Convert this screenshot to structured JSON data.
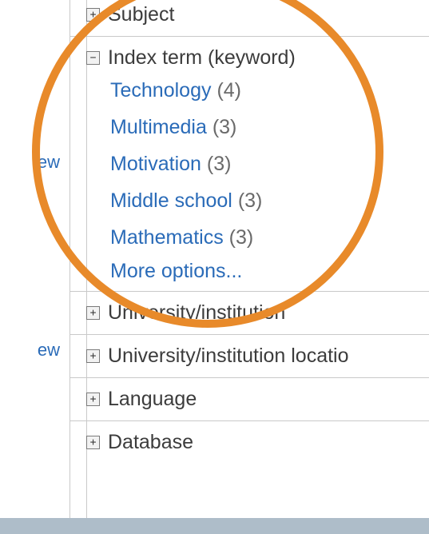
{
  "left": {
    "link1": "ew",
    "link2": "ew"
  },
  "filters": {
    "subject": {
      "label": "Subject",
      "expanded": false
    },
    "index_term": {
      "label": "Index term (keyword)",
      "expanded": true,
      "terms": [
        {
          "label": "Technology",
          "count": "(4)"
        },
        {
          "label": "Multimedia",
          "count": "(3)"
        },
        {
          "label": "Motivation",
          "count": "(3)"
        },
        {
          "label": "Middle school",
          "count": "(3)"
        },
        {
          "label": "Mathematics",
          "count": "(3)"
        }
      ],
      "more": "More options..."
    },
    "univ": {
      "label": "University/institution",
      "expanded": false
    },
    "univ_loc": {
      "label": "University/institution locatio",
      "expanded": false
    },
    "language": {
      "label": "Language",
      "expanded": false
    },
    "database": {
      "label": "Database",
      "expanded": false
    }
  },
  "glyph": {
    "plus": "+",
    "minus": "−"
  }
}
